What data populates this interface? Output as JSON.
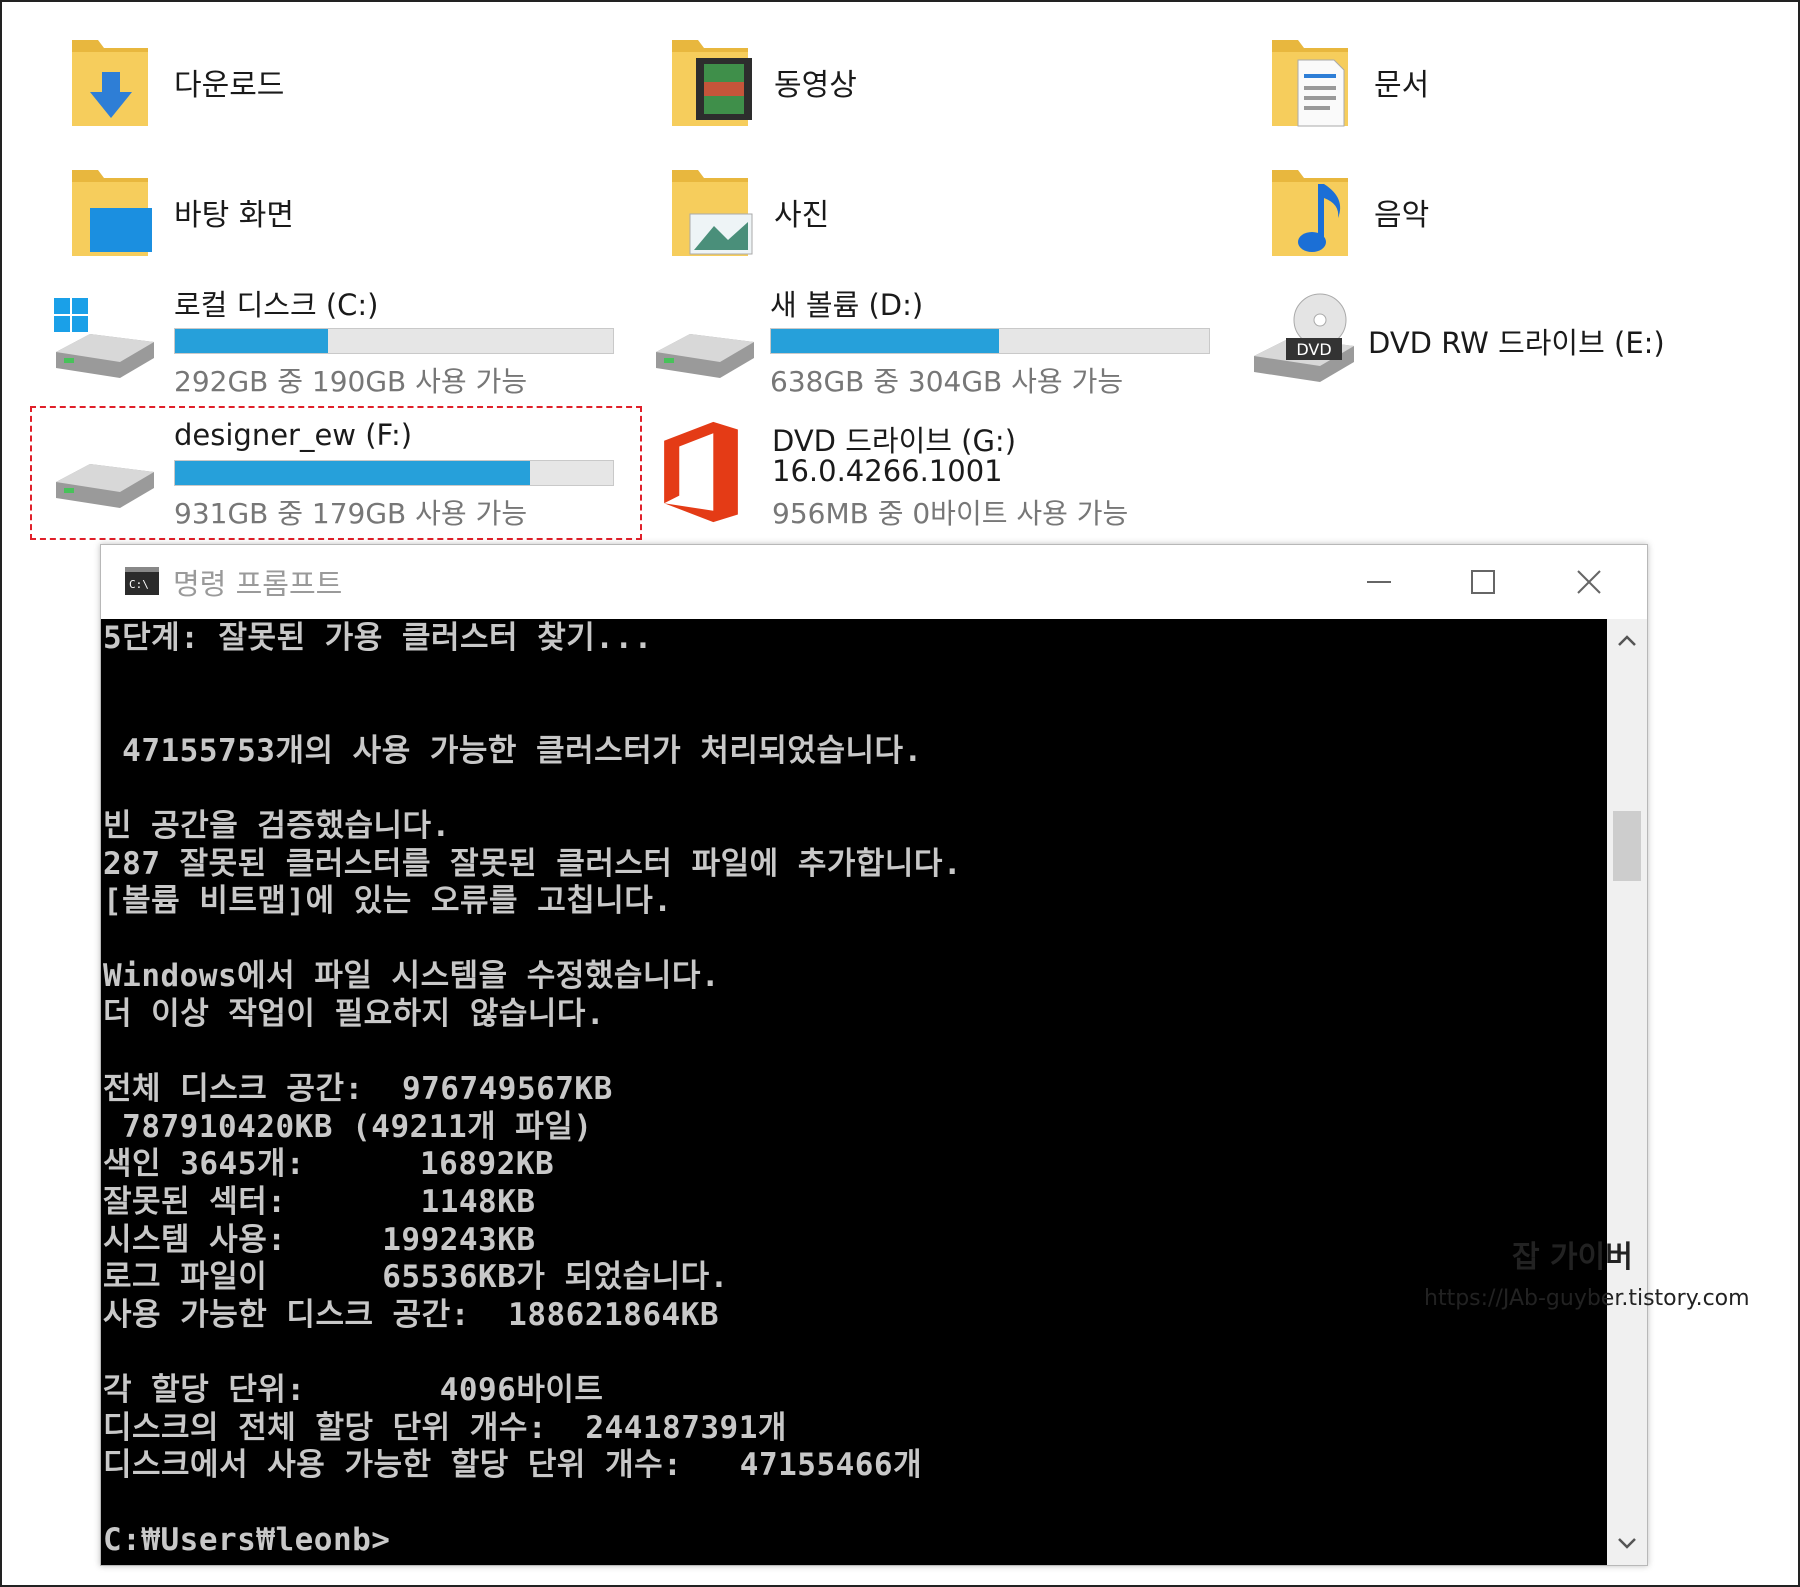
{
  "folders": [
    {
      "label": "다운로드",
      "icon": "download-folder-icon"
    },
    {
      "label": "동영상",
      "icon": "videos-folder-icon"
    },
    {
      "label": "문서",
      "icon": "documents-folder-icon"
    },
    {
      "label": "바탕 화면",
      "icon": "desktop-folder-icon"
    },
    {
      "label": "사진",
      "icon": "pictures-folder-icon"
    },
    {
      "label": "음악",
      "icon": "music-folder-icon"
    }
  ],
  "drives": {
    "c": {
      "name": "로컬 디스크 (C:)",
      "free": "292GB 중 190GB 사용 가능",
      "used_fraction": 0.35
    },
    "d": {
      "name": "새 볼륨 (D:)",
      "free": "638GB 중 304GB 사용 가능",
      "used_fraction": 0.52
    },
    "e": {
      "name": "DVD RW 드라이브 (E:)",
      "badge": "DVD"
    },
    "f": {
      "name": "designer_ew (F:)",
      "free": "931GB 중 179GB 사용 가능",
      "used_fraction": 0.81
    },
    "g": {
      "name": "DVD 드라이브 (G:)",
      "version": "16.0.4266.1001",
      "free": "956MB 중 0바이트 사용 가능"
    }
  },
  "cmd": {
    "title": "명령 프롬프트",
    "logo_text": "C:\\",
    "lines": [
      "5단계: 잘못된 가용 클러스터 찾기...",
      "",
      "",
      " 47155753개의 사용 가능한 클러스터가 처리되었습니다.",
      "",
      "빈 공간을 검증했습니다.",
      "287 잘못된 클러스터를 잘못된 클러스터 파일에 추가합니다.",
      "[볼륨 비트맵]에 있는 오류를 고칩니다.",
      "",
      "Windows에서 파일 시스템을 수정했습니다.",
      "더 이상 작업이 필요하지 않습니다.",
      "",
      "전체 디스크 공간:  976749567KB",
      " 787910420KB (49211개 파일)",
      "색인 3645개:      16892KB",
      "잘못된 섹터:       1148KB",
      "시스템 사용:     199243KB",
      "로그 파일이      65536KB가 되었습니다.",
      "사용 가능한 디스크 공간:  188621864KB",
      "",
      "각 할당 단위:       4096바이트",
      "디스크의 전체 할당 단위 개수:  244187391개",
      "디스크에서 사용 가능한 할당 단위 개수:   47155466개",
      "",
      "C:₩Users₩leonb>"
    ]
  },
  "watermark": {
    "title": "잡 가이버",
    "url": "https://JAb-guyber.tistory.com"
  },
  "colors": {
    "bar_fill": "#26a0da",
    "highlight": "#e0202a",
    "cmd_bg": "#000000",
    "folder": "#f3c04a"
  }
}
